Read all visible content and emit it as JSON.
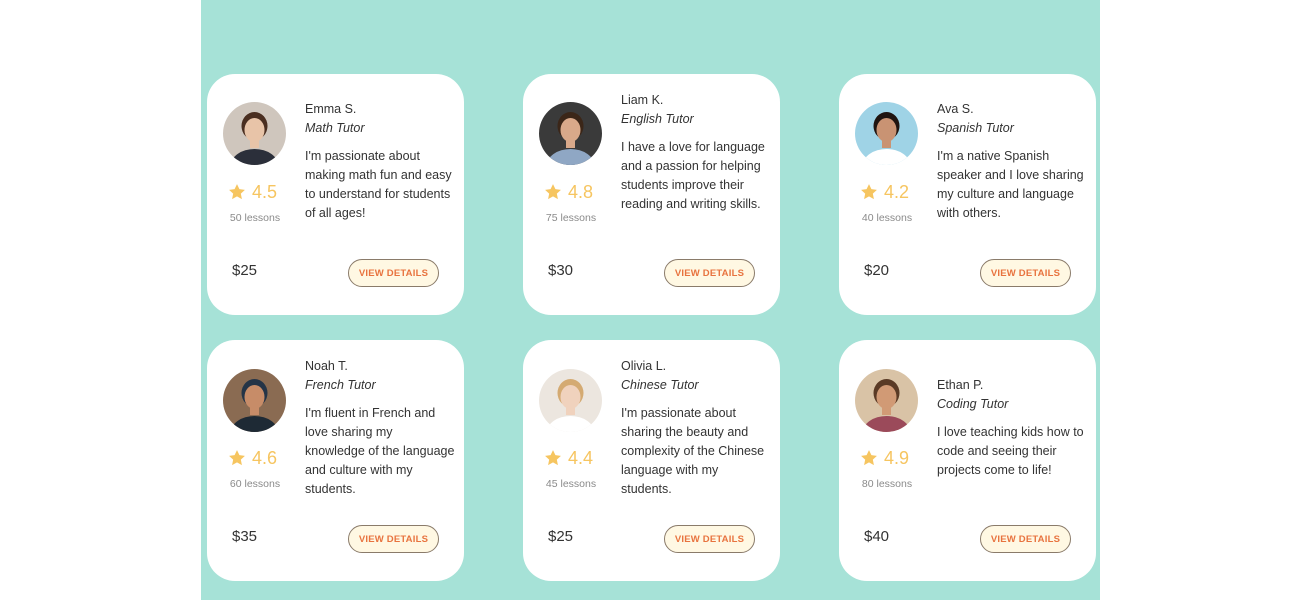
{
  "tutors": [
    {
      "name": "Emma S.",
      "subject": "Math Tutor",
      "bio": "I'm passionate about making math fun and easy to understand for students of all ages!",
      "rating": "4.5",
      "lessons": "50 lessons",
      "price": "$25",
      "button_label": "VIEW DETAILS",
      "avatar": {
        "bg": "#cfc6bd",
        "skin": "#e8c4a8",
        "hair": "#4a2e20",
        "shirt": "#2b2f3a"
      }
    },
    {
      "name": "Liam K.",
      "subject": "English Tutor",
      "bio": "I have a love for language and a passion for helping students improve their reading and writing skills.",
      "rating": "4.8",
      "lessons": "75 lessons",
      "price": "$30",
      "button_label": "VIEW DETAILS",
      "avatar": {
        "bg": "#3a3a3a",
        "skin": "#d9a98a",
        "hair": "#3b2618",
        "shirt": "#8fa7c4"
      }
    },
    {
      "name": "Ava S.",
      "subject": "Spanish Tutor",
      "bio": "I'm a native Spanish speaker and I love sharing my culture and language with others.",
      "rating": "4.2",
      "lessons": "40 lessons",
      "price": "$20",
      "button_label": "VIEW DETAILS",
      "avatar": {
        "bg": "#9fd3e6",
        "skin": "#c99373",
        "hair": "#1f1410",
        "shirt": "#ffffff"
      }
    },
    {
      "name": "Noah T.",
      "subject": "French Tutor",
      "bio": "I'm fluent in French and love sharing my knowledge of the language and culture with my students.",
      "rating": "4.6",
      "lessons": "60 lessons",
      "price": "$35",
      "button_label": "VIEW DETAILS",
      "avatar": {
        "bg": "#8a6b52",
        "skin": "#c78c68",
        "hair": "#243447",
        "shirt": "#1e2a35"
      }
    },
    {
      "name": "Olivia L.",
      "subject": "Chinese Tutor",
      "bio": "I'm passionate about sharing the beauty and complexity of the Chinese language with my students.",
      "rating": "4.4",
      "lessons": "45 lessons",
      "price": "$25",
      "button_label": "VIEW DETAILS",
      "avatar": {
        "bg": "#ece6df",
        "skin": "#f0d2bd",
        "hair": "#d4aa72",
        "shirt": "#ffffff"
      }
    },
    {
      "name": "Ethan P.",
      "subject": "Coding Tutor",
      "bio": "I love teaching kids how to code and seeing their projects come to life!",
      "rating": "4.9",
      "lessons": "80 lessons",
      "price": "$40",
      "button_label": "VIEW DETAILS",
      "avatar": {
        "bg": "#d9c3a6",
        "skin": "#d19a75",
        "hair": "#5a3a25",
        "shirt": "#9b4a5a"
      }
    }
  ],
  "colors": {
    "panel_bg": "#a6e2d7",
    "star": "#f6c560",
    "button_text": "#e8733f",
    "button_bg": "#fff8e3"
  },
  "icons": {
    "rating": "star-icon"
  }
}
